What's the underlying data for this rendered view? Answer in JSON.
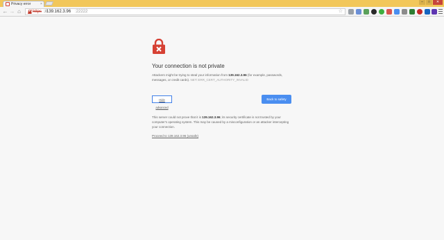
{
  "tab": {
    "title": "Privacy error",
    "close": "×"
  },
  "window_controls": {
    "minimize": "–",
    "maximize": "□",
    "close": "✕"
  },
  "address": {
    "scheme": "https",
    "separator": "://",
    "host": "139.162.3.96",
    "port": ":22222"
  },
  "interstitial": {
    "heading": "Your connection is not private",
    "message_prefix": "Attackers might be trying to steal your information from ",
    "message_host": "139.162.3.96",
    "message_suffix": " (for example, passwords, messages, or credit cards). ",
    "error_code": "NET::ERR_CERT_AUTHORITY_INVALID",
    "hide_advanced": "Hide advanced",
    "back_to_safety": "Back to safety",
    "detail_prefix": "This server could not prove that it is ",
    "detail_host": "139.162.3.96",
    "detail_suffix": "; its security certificate is not trusted by your computer's operating system. This may be caused by a misconfiguration or an attacker intercepting your connection.",
    "proceed_link": "Proceed to 139.162.3.96 (unsafe)"
  },
  "colors": {
    "accent": "#4a8ef0",
    "lock_red": "#d64134",
    "titlebar": "#f2c75a"
  }
}
